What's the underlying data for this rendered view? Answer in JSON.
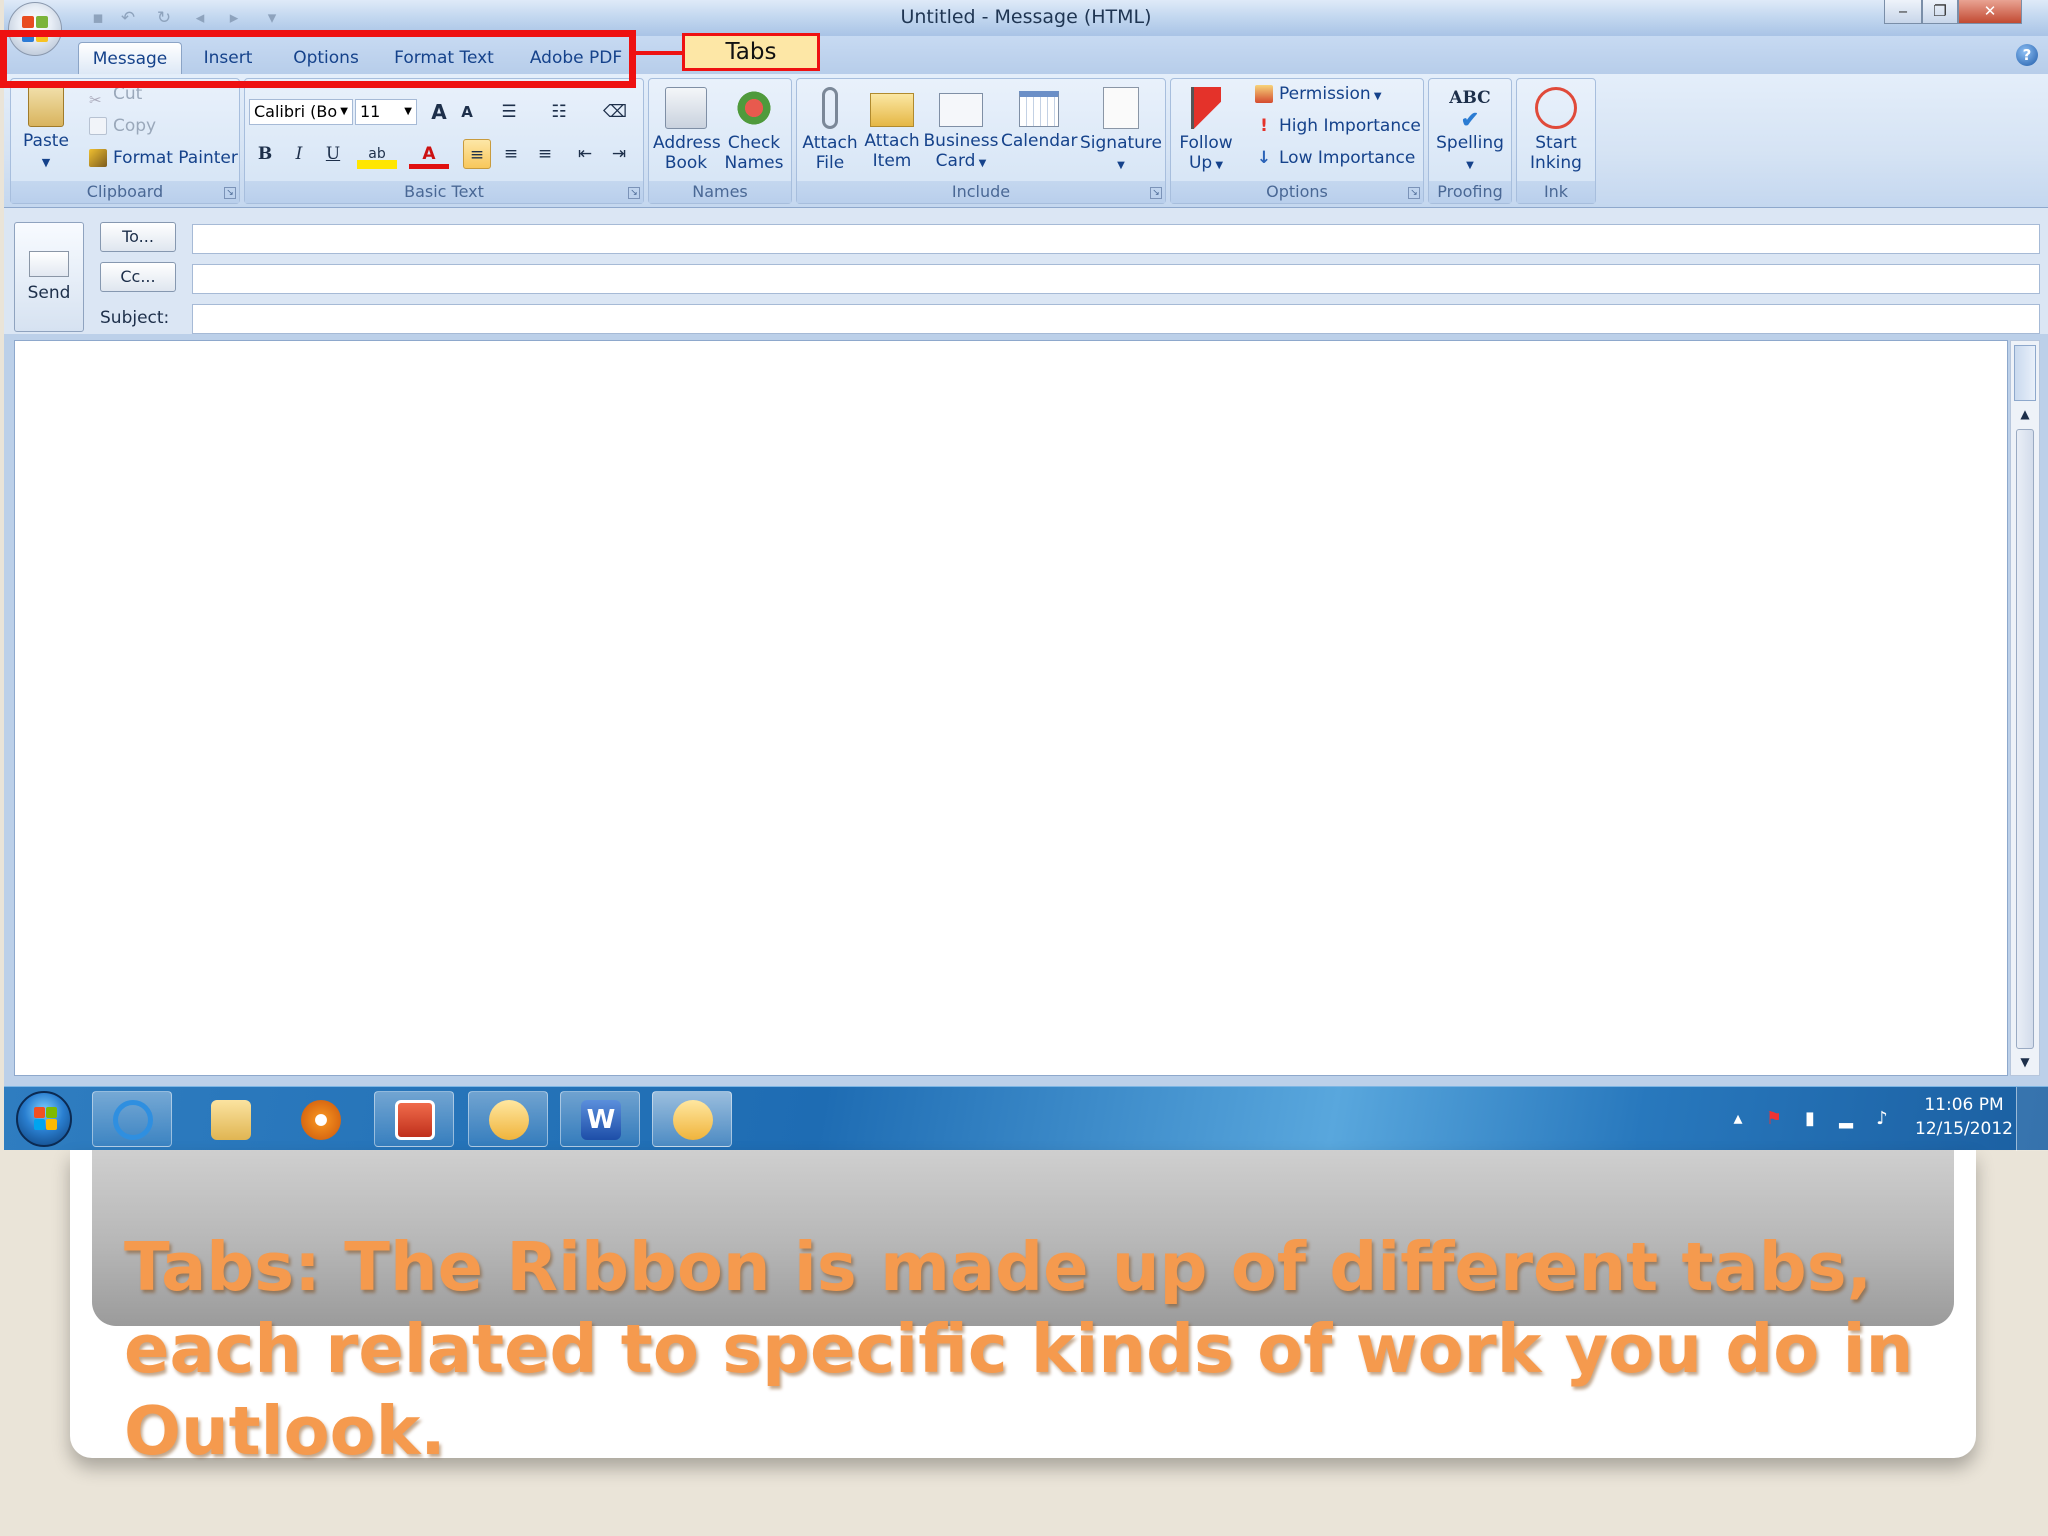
{
  "window": {
    "title": "Untitled - Message (HTML)",
    "controls": [
      "minimize",
      "restore",
      "close"
    ]
  },
  "quick_access": [
    "save-icon",
    "undo-icon",
    "redo-icon",
    "back-icon",
    "forward-icon",
    "customize-icon"
  ],
  "tabs": [
    {
      "label": "Message",
      "selected": true
    },
    {
      "label": "Insert",
      "selected": false
    },
    {
      "label": "Options",
      "selected": false
    },
    {
      "label": "Format Text",
      "selected": false
    },
    {
      "label": "Adobe PDF",
      "selected": false
    }
  ],
  "ribbon": {
    "clipboard": {
      "label": "Clipboard",
      "paste": "Paste",
      "cut": "Cut",
      "copy": "Copy",
      "format_painter": "Format Painter"
    },
    "basic_text": {
      "label": "Basic Text",
      "font": "Calibri (Bo",
      "size": "11",
      "grow": "A",
      "shrink": "A",
      "bold": "B",
      "italic": "I",
      "underline": "U",
      "highlight": "ab",
      "font_color": "A"
    },
    "names": {
      "label": "Names",
      "address_book": [
        "Address",
        "Book"
      ],
      "check_names": [
        "Check",
        "Names"
      ]
    },
    "include": {
      "label": "Include",
      "attach_file": [
        "Attach",
        "File"
      ],
      "attach_item": [
        "Attach",
        "Item"
      ],
      "business_card": [
        "Business",
        "Card"
      ],
      "calendar": "Calendar",
      "signature": "Signature"
    },
    "options": {
      "label": "Options",
      "follow_up": [
        "Follow",
        "Up"
      ],
      "permission": "Permission",
      "high_importance": "High Importance",
      "low_importance": "Low Importance"
    },
    "proofing": {
      "label": "Proofing",
      "spelling": "Spelling",
      "spelling_icon_text": "ABC"
    },
    "ink": {
      "label": "Ink",
      "start_inking": [
        "Start",
        "Inking"
      ]
    }
  },
  "compose": {
    "send": "Send",
    "to_button": "To...",
    "cc_button": "Cc...",
    "subject_label": "Subject:",
    "to_value": "",
    "cc_value": "",
    "subject_value": ""
  },
  "taskbar": {
    "apps": [
      "internet-explorer-icon",
      "file-explorer-icon",
      "media-player-icon",
      "outlook-calendar-icon",
      "outlook-icon",
      "word-icon",
      "outlook-icon"
    ],
    "time": "11:06 PM",
    "date": "12/15/2012"
  },
  "annotation": {
    "callout": "Tabs",
    "color": "#ee1111"
  },
  "caption": {
    "text": "Tabs: The Ribbon is made up of different tabs, each related to specific kinds of work you do in Outlook.",
    "color": "#f59a4e"
  }
}
